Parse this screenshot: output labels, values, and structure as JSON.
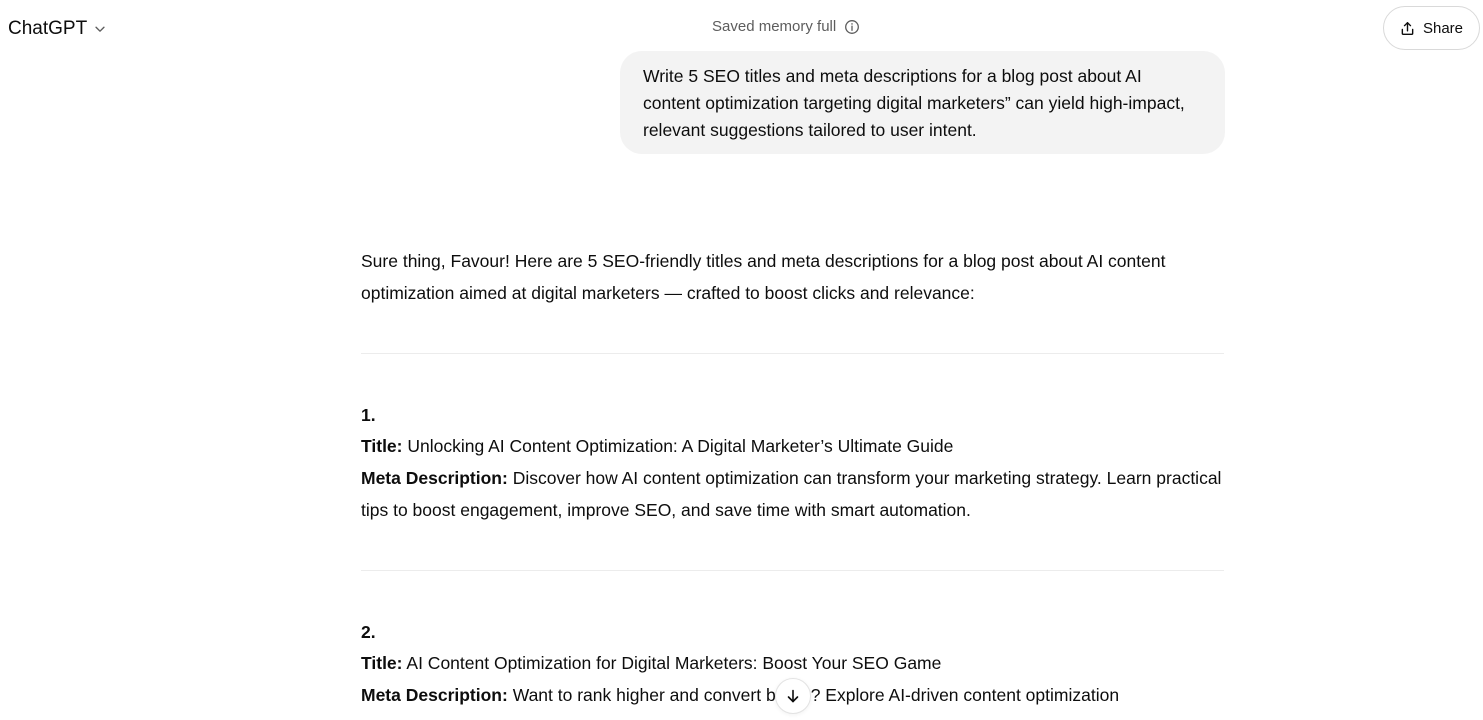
{
  "header": {
    "model_label": "ChatGPT",
    "memory_status": "Saved memory full",
    "share_label": "Share"
  },
  "user_message": {
    "text": "Write 5 SEO titles and meta descriptions for a blog post about AI content optimization targeting digital marketers” can yield high-impact, relevant suggestions tailored to user intent."
  },
  "assistant_message": {
    "intro": "Sure thing, Favour! Here are 5 SEO-friendly titles and meta descriptions for a blog post about AI content optimization aimed at digital marketers — crafted to boost clicks and relevance:",
    "items": [
      {
        "number": "1.",
        "title_label": "Title:",
        "title": "Unlocking AI Content Optimization: A Digital Marketer’s Ultimate Guide",
        "meta_label": "Meta Description:",
        "meta": "Discover how AI content optimization can transform your marketing strategy. Learn practical tips to boost engagement, improve SEO, and save time with smart automation."
      },
      {
        "number": "2.",
        "title_label": "Title:",
        "title": "AI Content Optimization for Digital Marketers: Boost Your SEO Game",
        "meta_label": "Meta Description:",
        "meta": "Want to rank higher and convert better? Explore AI-driven content optimization"
      }
    ]
  },
  "icons": {
    "model_chevron": "chevron-down-icon",
    "memory_info": "info-icon",
    "share": "share-icon",
    "scroll_down": "arrow-down-icon"
  }
}
